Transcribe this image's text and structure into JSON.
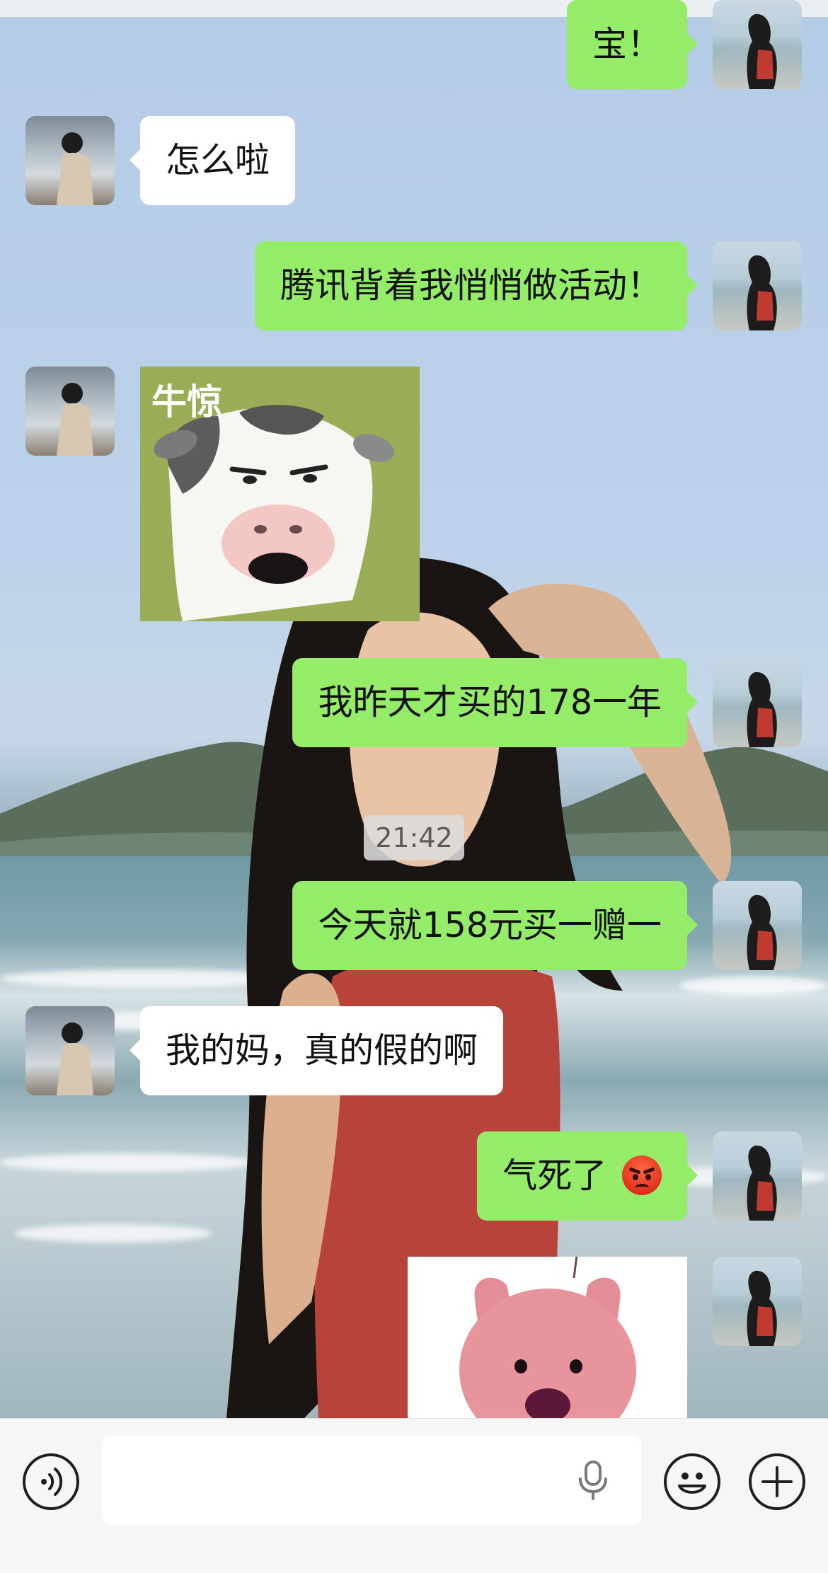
{
  "colors": {
    "self_bubble": "#95ec69",
    "peer_bubble": "#ffffff",
    "input_bar": "#f6f6f6"
  },
  "messages": [
    {
      "sender": "self",
      "type": "text",
      "text": "宝！"
    },
    {
      "sender": "peer",
      "type": "text",
      "text": "怎么啦"
    },
    {
      "sender": "self",
      "type": "text",
      "text": "腾讯背着我悄悄做活动！"
    },
    {
      "sender": "peer",
      "type": "sticker",
      "text": "牛惊",
      "description": "cow-face-sticker"
    },
    {
      "sender": "self",
      "type": "text",
      "text": "我昨天才买的178一年"
    },
    {
      "sender": "system",
      "type": "timestamp",
      "text": "21:42"
    },
    {
      "sender": "self",
      "type": "text",
      "text": "今天就158元买一赠一"
    },
    {
      "sender": "peer",
      "type": "text",
      "text": "我的妈，真的假的啊"
    },
    {
      "sender": "self",
      "type": "text",
      "text": "气死了",
      "emoji": "angry-face-emoji"
    },
    {
      "sender": "self",
      "type": "sticker",
      "description": "pink-bunny-sticker"
    }
  ],
  "input_bar": {
    "voice_icon": "voice-mode-icon",
    "mic_icon": "microphone-icon",
    "emoji_icon": "emoji-icon",
    "plus_icon": "plus-icon",
    "placeholder": ""
  }
}
